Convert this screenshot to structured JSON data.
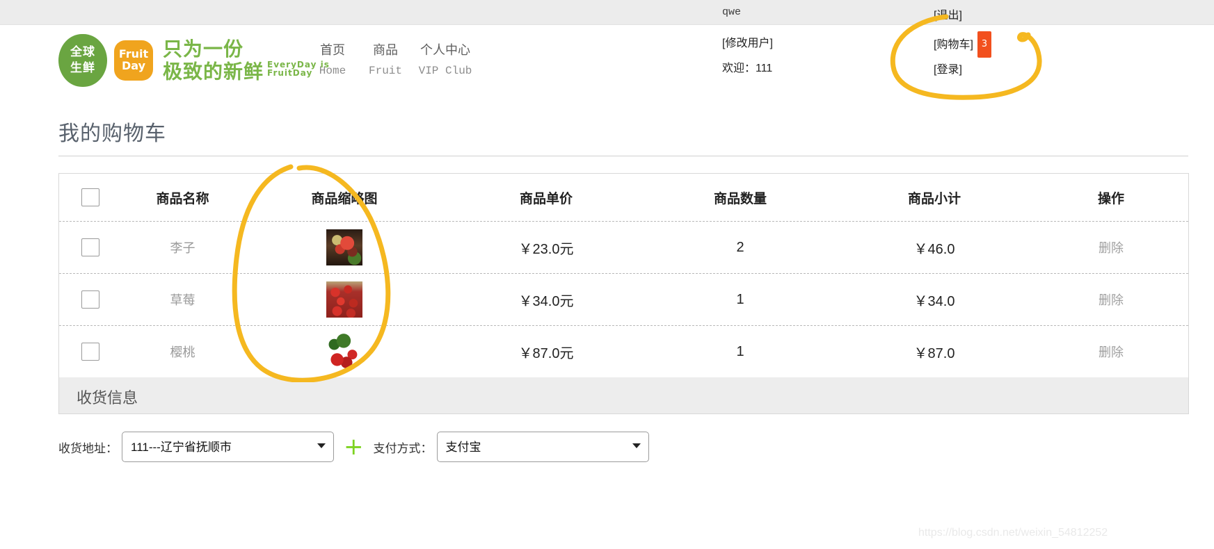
{
  "topbar": {
    "username": "qwe",
    "logout_label": "[退出]"
  },
  "brand": {
    "badge_line1": "全球",
    "badge_line2": "生鲜",
    "fruit_line1": "Fruit",
    "fruit_line2": "Day",
    "slogan_line1": "只为一份",
    "slogan_line2": "极致的新鲜",
    "slogan_en_line1": "EveryDay is",
    "slogan_en_line2": "FruitDay",
    "badge_color": "#6aa541",
    "fruitday_color": "#f0a41e",
    "slogan_color": "#7ab648"
  },
  "nav": [
    {
      "cn": "首页",
      "en": "Home"
    },
    {
      "cn": "商品",
      "en": "Fruit"
    },
    {
      "cn": "个人中心",
      "en": "VIP Club"
    }
  ],
  "account": {
    "edit_user_label": "[修改用户]",
    "welcome_label": "欢迎：111",
    "cart_label": "[购物车]",
    "cart_count": "3",
    "cart_badge_color": "#f2501e",
    "login_label": "[登录]"
  },
  "page": {
    "title": "我的购物车"
  },
  "cart": {
    "headers": {
      "checkbox": "",
      "name": "商品名称",
      "thumb": "商品缩略图",
      "price": "商品单价",
      "qty": "商品数量",
      "subtotal": "商品小计",
      "action": "操作"
    },
    "rows": [
      {
        "name": "李子",
        "thumb": "plum-thumbnail",
        "price": "￥23.0元",
        "qty": "2",
        "subtotal": "￥46.0",
        "action": "删除"
      },
      {
        "name": "草莓",
        "thumb": "strawberry-thumbnail",
        "price": "￥34.0元",
        "qty": "1",
        "subtotal": "￥34.0",
        "action": "删除"
      },
      {
        "name": "樱桃",
        "thumb": "cherry-thumbnail",
        "price": "￥87.0元",
        "qty": "1",
        "subtotal": "￥87.0",
        "action": "删除"
      }
    ]
  },
  "shipping": {
    "section_title": "收货信息",
    "address_label": "收货地址：",
    "address_value": "111---辽宁省抚顺市",
    "add_address_icon": "plus-icon",
    "payment_label": "支付方式：",
    "payment_value": "支付宝"
  },
  "annotations": {
    "marker_color": "#f5b820",
    "highlight_1": "cart-area-circle",
    "highlight_2": "thumbnail-column-circle"
  },
  "watermark": {
    "text": "https://blog.csdn.net/weixin_54812252"
  }
}
